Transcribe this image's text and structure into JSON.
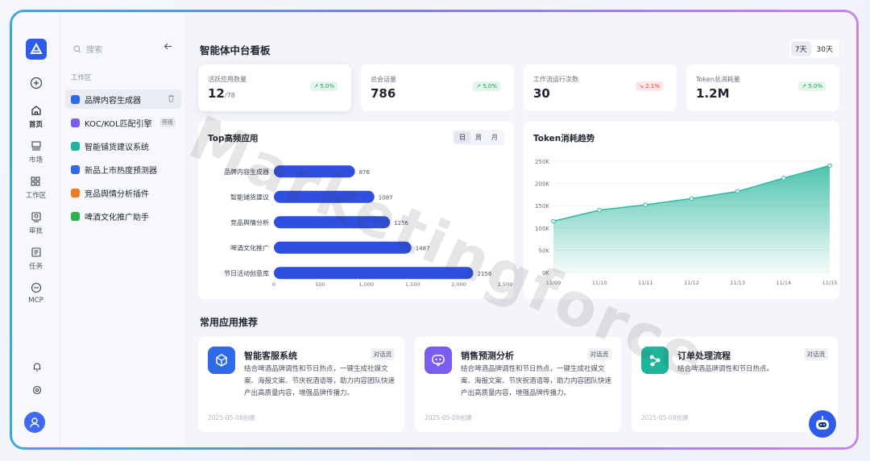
{
  "sidebar": {
    "items": [
      {
        "label": "首页",
        "icon": "home-icon"
      },
      {
        "label": "市场",
        "icon": "market-icon"
      },
      {
        "label": "工作区",
        "icon": "workspace-icon"
      },
      {
        "label": "审批",
        "icon": "approval-icon"
      },
      {
        "label": "任务",
        "icon": "task-icon"
      },
      {
        "label": "MCP",
        "icon": "mcp-icon"
      }
    ]
  },
  "panel": {
    "search_placeholder": "搜索",
    "section_label": "工作区",
    "items": [
      {
        "label": "品牌内容生成器",
        "color": "#2f6be8"
      },
      {
        "label": "KOC/KOL匹配引擎",
        "color": "#7b5cf0",
        "tag": "停用"
      },
      {
        "label": "智能铺货建议系统",
        "color": "#1fb59a"
      },
      {
        "label": "新品上市热度预测器",
        "color": "#2f6be8"
      },
      {
        "label": "竞品舆情分析插件",
        "color": "#f07a1f"
      },
      {
        "label": "啤酒文化推广助手",
        "color": "#2bb24c"
      }
    ]
  },
  "header": {
    "title": "智能体中台看板",
    "ranges": [
      "7天",
      "30天"
    ]
  },
  "kpis": [
    {
      "label": "活跃应用数量",
      "value": "12",
      "suffix": "/78",
      "badge": "5.0%",
      "trend": "up"
    },
    {
      "label": "总会话量",
      "value": "786",
      "suffix": "",
      "badge": "5.0%",
      "trend": "up"
    },
    {
      "label": "工作流运行次数",
      "value": "30",
      "suffix": "",
      "badge": "2.1%",
      "trend": "down"
    },
    {
      "label": "Token总消耗量",
      "value": "1.2M",
      "suffix": "",
      "badge": "5.0%",
      "trend": "up"
    }
  ],
  "top_apps": {
    "title": "Top高频应用",
    "tabs": [
      "日",
      "周",
      "月"
    ]
  },
  "token_trend": {
    "title": "Token消耗趋势"
  },
  "chart_data": [
    {
      "type": "bar",
      "orientation": "horizontal",
      "categories": [
        "品牌内容生成器",
        "智能铺货建议",
        "竞品舆情分析",
        "啤酒文化推广",
        "节日活动创意库"
      ],
      "values": [
        876,
        1087,
        1256,
        1487,
        2156
      ],
      "xlim": [
        0,
        2500
      ],
      "xticks": [
        "0",
        "500",
        "1,000",
        "1,500",
        "2,000",
        "2,500"
      ],
      "color": "#2f4fe0"
    },
    {
      "type": "area",
      "categories": [
        "11/09",
        "11/10",
        "11/11",
        "11/12",
        "11/13",
        "11/14",
        "11/15"
      ],
      "values": [
        115000,
        140000,
        152000,
        166000,
        182000,
        212000,
        240000
      ],
      "ylim": [
        0,
        250000
      ],
      "yticks": [
        "0K",
        "50K",
        "100K",
        "150K",
        "200K",
        "250K"
      ],
      "color": "#2fb9a0"
    }
  ],
  "recommend": {
    "title": "常用应用推荐",
    "cards": [
      {
        "name": "智能客服系统",
        "tag": "对话流",
        "desc": "结合啤酒品牌调性和节日热点，一键生成社媒文案、海报文案、节庆祝酒语等，助力内容团队快速产出高质量内容，增强品牌传播力。",
        "date": "2025-05-08创建",
        "color": "#2f6be8"
      },
      {
        "name": "销售预测分析",
        "tag": "对话流",
        "desc": "结合啤酒品牌调性和节日热点，一键生成社媒文案、海报文案、节庆祝酒语等，助力内容团队快速产出高质量内容，增强品牌传播力。",
        "date": "2025-05-08创建",
        "color": "#7b5cf0"
      },
      {
        "name": "订单处理流程",
        "tag": "对话流",
        "desc": "结合啤酒品牌调性和节日热点。",
        "date": "2025-05-08创建",
        "color": "#1fb59a"
      }
    ]
  },
  "watermark": "Marketingforce"
}
